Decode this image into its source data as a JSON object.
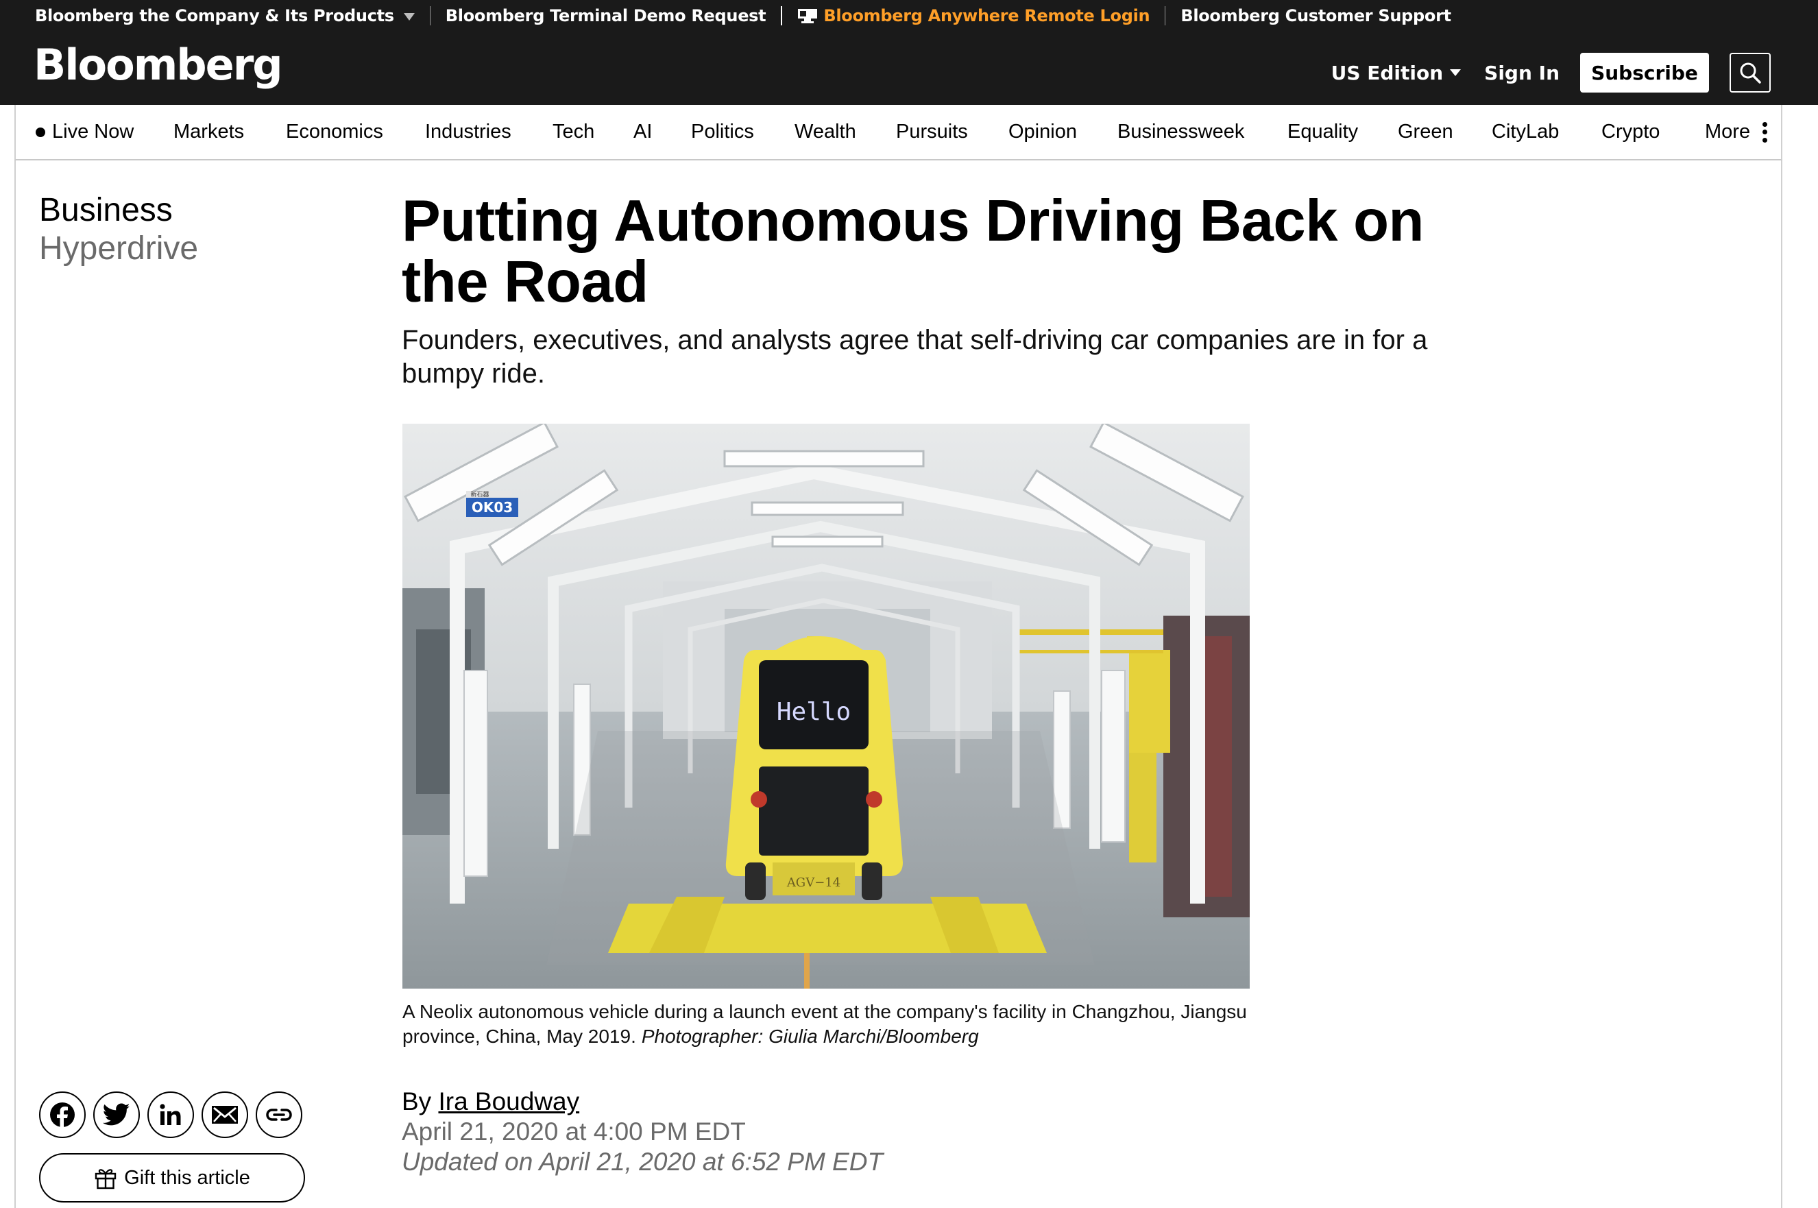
{
  "util_bar": {
    "company": "Bloomberg the Company & Its Products",
    "terminal_demo": "Bloomberg Terminal Demo Request",
    "anywhere_login": "Bloomberg Anywhere Remote Login",
    "support": "Bloomberg Customer Support"
  },
  "header": {
    "logo": "Bloomberg",
    "edition": "US Edition",
    "sign_in": "Sign In",
    "subscribe": "Subscribe"
  },
  "nav": {
    "live": "Live Now",
    "items": [
      "Markets",
      "Economics",
      "Industries",
      "Tech",
      "AI",
      "Politics",
      "Wealth",
      "Pursuits",
      "Opinion",
      "Businessweek",
      "Equality",
      "Green",
      "CityLab",
      "Crypto"
    ],
    "more": "More"
  },
  "section": {
    "name": "Business",
    "sub": "Hyperdrive"
  },
  "article": {
    "headline": "Putting Autonomous Driving Back on the Road",
    "dek": "Founders, executives, and analysts agree that self-driving car companies are in for a bumpy ride.",
    "image": {
      "sign_text": "OK03",
      "sign_small": "新石器",
      "screen_text": "Hello",
      "plate_text": "AGV−14"
    },
    "caption": "A Neolix autonomous vehicle during a launch event at the company's facility in Changzhou, Jiangsu province, China, May 2019.",
    "credit": "Photographer: Giulia Marchi/Bloomberg",
    "byline_prefix": "By",
    "author": "Ira Boudway",
    "date": "April 21, 2020 at 4:00 PM EDT",
    "updated": "Updated on April 21, 2020 at 6:52 PM EDT"
  },
  "share": {
    "gift": "Gift this article",
    "icons": [
      "facebook-icon",
      "twitter-icon",
      "linkedin-icon",
      "email-icon",
      "link-icon"
    ]
  },
  "colors": {
    "header_bg": "#1a1a1a",
    "accent_orange": "#ff9f28",
    "muted_text": "#6a6a6a",
    "vehicle_yellow": "#f0e04a"
  }
}
